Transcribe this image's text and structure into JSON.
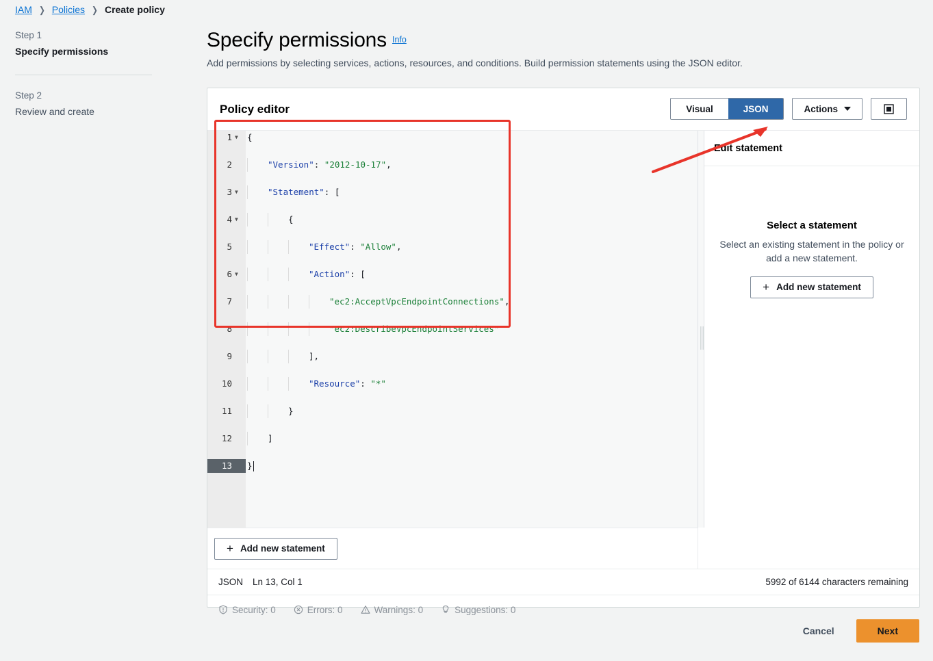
{
  "breadcrumb": {
    "items": [
      {
        "label": "IAM",
        "type": "link"
      },
      {
        "label": "Policies",
        "type": "link"
      },
      {
        "label": "Create policy",
        "type": "current"
      }
    ],
    "separator": "❯"
  },
  "steps": [
    {
      "kicker": "Step 1",
      "title": "Specify permissions",
      "active": true
    },
    {
      "kicker": "Step 2",
      "title": "Review and create",
      "active": false
    }
  ],
  "header": {
    "title": "Specify permissions",
    "info_label": "Info",
    "subtitle": "Add permissions by selecting services, actions, resources, and conditions. Build permission statements using the JSON editor."
  },
  "editor": {
    "card_title": "Policy editor",
    "tabs": [
      {
        "label": "Visual",
        "active": false
      },
      {
        "label": "JSON",
        "active": true
      }
    ],
    "actions_label": "Actions",
    "fullscreen_icon": "fullscreen-icon",
    "add_statement_label": "Add new statement",
    "lines": [
      {
        "num": "1",
        "fold": true,
        "indent": 0,
        "code": "{",
        "active": false
      },
      {
        "num": "2",
        "fold": false,
        "indent": 1,
        "code": "\"Version\": \"2012-10-17\",",
        "active": false
      },
      {
        "num": "3",
        "fold": true,
        "indent": 1,
        "code": "\"Statement\": [",
        "active": false
      },
      {
        "num": "4",
        "fold": true,
        "indent": 2,
        "code": "{",
        "active": false
      },
      {
        "num": "5",
        "fold": false,
        "indent": 3,
        "code": "\"Effect\": \"Allow\",",
        "active": false
      },
      {
        "num": "6",
        "fold": true,
        "indent": 3,
        "code": "\"Action\": [",
        "active": false
      },
      {
        "num": "7",
        "fold": false,
        "indent": 4,
        "code": "\"ec2:AcceptVpcEndpointConnections\",",
        "active": false
      },
      {
        "num": "8",
        "fold": false,
        "indent": 4,
        "code": "\"ec2:DescribeVpcEndpointServices\"",
        "active": false
      },
      {
        "num": "9",
        "fold": false,
        "indent": 3,
        "code": "],",
        "active": false
      },
      {
        "num": "10",
        "fold": false,
        "indent": 3,
        "code": "\"Resource\": \"*\"",
        "active": false
      },
      {
        "num": "11",
        "fold": false,
        "indent": 2,
        "code": "}",
        "active": false
      },
      {
        "num": "12",
        "fold": false,
        "indent": 1,
        "code": "]",
        "active": false
      },
      {
        "num": "13",
        "fold": false,
        "indent": 0,
        "code": "}",
        "active": true
      }
    ],
    "policy_json": {
      "Version": "2012-10-17",
      "Statement": [
        {
          "Effect": "Allow",
          "Action": [
            "ec2:AcceptVpcEndpointConnections",
            "ec2:DescribeVpcEndpointServices"
          ],
          "Resource": "*"
        }
      ]
    }
  },
  "side_panel": {
    "title": "Edit statement",
    "empty_title": "Select a statement",
    "empty_text": "Select an existing statement in the policy or add a new statement.",
    "add_button_label": "Add new statement"
  },
  "status": {
    "language": "JSON",
    "position": "Ln 13, Col 1",
    "characters": "5992 of 6144 characters remaining",
    "issues": [
      {
        "icon": "shield-icon",
        "label": "Security: 0"
      },
      {
        "icon": "error-circle-icon",
        "label": "Errors: 0"
      },
      {
        "icon": "warning-triangle-icon",
        "label": "Warnings: 0"
      },
      {
        "icon": "lightbulb-icon",
        "label": "Suggestions: 0"
      }
    ]
  },
  "footer": {
    "cancel_label": "Cancel",
    "next_label": "Next"
  },
  "colors": {
    "accent_blue": "#0972d3",
    "tab_active_blue": "#2f68a8",
    "primary_orange": "#ec912d",
    "annotation_red": "#e8342a",
    "json_key": "#1b3fa8",
    "json_string": "#1a7f37",
    "page_background": "#f2f3f3"
  }
}
